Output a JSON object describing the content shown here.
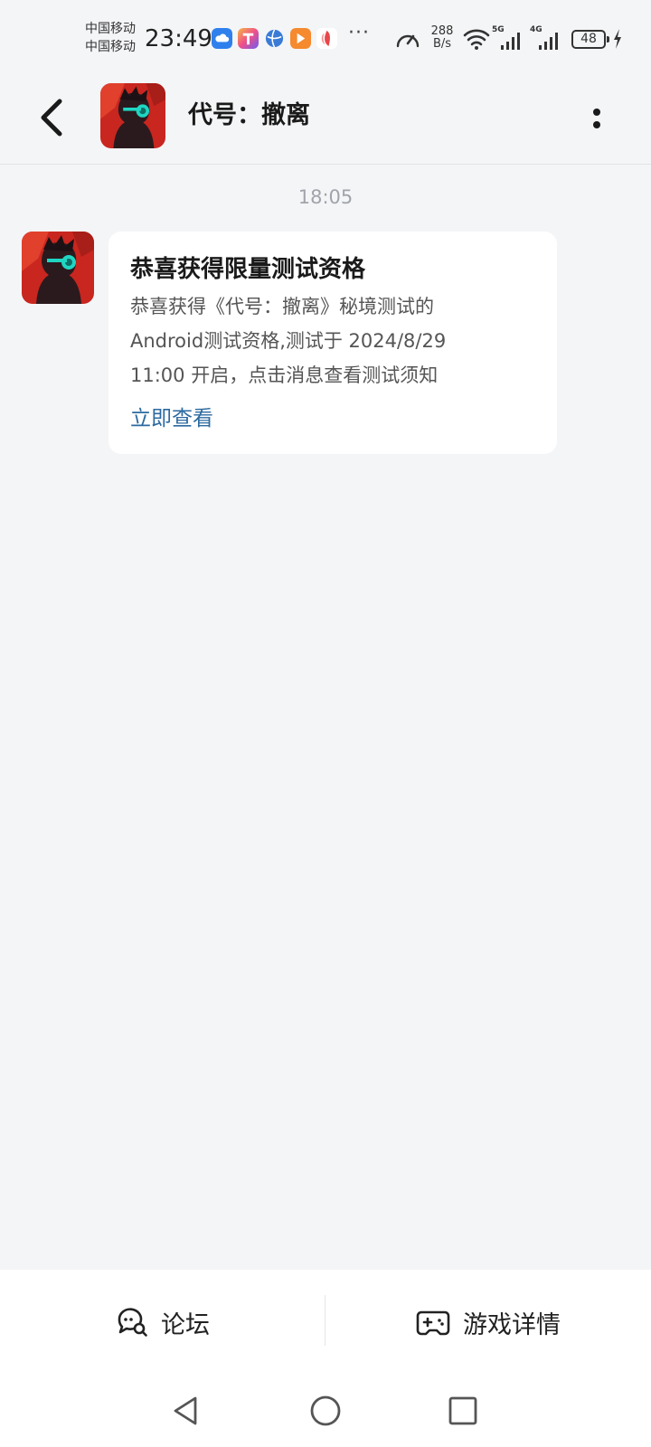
{
  "status_bar": {
    "carrier_1": "中国移动",
    "carrier_2": "中国移动",
    "time": "23:49",
    "net_speed_value": "288",
    "net_speed_unit": "B/s",
    "net_type_1": "5G",
    "net_type_2": "4G",
    "battery": "48",
    "notification_icons": [
      "cloud-icon",
      "app-t-icon",
      "globe-icon",
      "play-icon",
      "petal-icon"
    ],
    "colors": {
      "cloud": "#2f80ed",
      "app_t": "#f0508a",
      "globe": "#3a7bd5",
      "play": "#f58a2e",
      "petal": "#e8474a"
    }
  },
  "header": {
    "title": "代号：撤离",
    "avatar_icon": "game-avatar-icon"
  },
  "chat": {
    "timestamp": "18:05",
    "message": {
      "title": "恭喜获得限量测试资格",
      "body_line_1": "恭喜获得《代号：撤离》秘境测试的",
      "body_line_2": "Android测试资格,测试于 2024/8/29",
      "body_line_3": "11:00 开启，点击消息查看测试须知",
      "link": "立即查看"
    }
  },
  "action_bar": {
    "forum_label": "论坛",
    "details_label": "游戏详情"
  },
  "theme": {
    "background": "#f4f5f7",
    "card": "#ffffff",
    "link": "#2c6aa0",
    "muted": "#a0a4aa"
  }
}
